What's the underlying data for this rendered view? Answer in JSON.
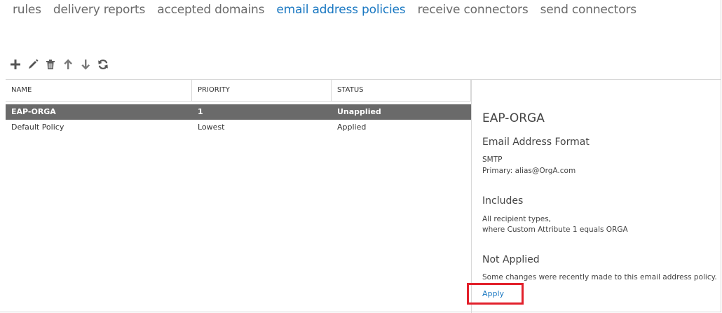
{
  "nav": {
    "items": [
      {
        "label": "rules",
        "active": false
      },
      {
        "label": "delivery reports",
        "active": false
      },
      {
        "label": "accepted domains",
        "active": false
      },
      {
        "label": "email address policies",
        "active": true
      },
      {
        "label": "receive connectors",
        "active": false
      },
      {
        "label": "send connectors",
        "active": false
      }
    ]
  },
  "toolbar": {
    "icons": [
      "add-icon",
      "edit-icon",
      "delete-icon",
      "move-up-icon",
      "move-down-icon",
      "refresh-icon"
    ],
    "icon_color": "#555555"
  },
  "table": {
    "columns": [
      "NAME",
      "PRIORITY",
      "STATUS"
    ],
    "rows": [
      {
        "name": "EAP-ORGA",
        "priority": "1",
        "status": "Unapplied",
        "selected": true
      },
      {
        "name": "Default Policy",
        "priority": "Lowest",
        "status": "Applied",
        "selected": false
      }
    ],
    "selected_row_color": "#6a6a6a"
  },
  "details": {
    "title": "EAP-ORGA",
    "format_heading": "Email Address Format",
    "format_type": "SMTP",
    "format_value": "Primary: alias@OrgA.com",
    "includes_heading": "Includes",
    "includes_line1": "All recipient types,",
    "includes_line2": "where Custom Attribute 1 equals ORGA",
    "status_heading": "Not Applied",
    "status_text": "Some changes were recently made to this email address policy.",
    "apply_label": "Apply"
  },
  "colors": {
    "accent": "#1a78c2",
    "highlight_border": "#e2202b"
  }
}
